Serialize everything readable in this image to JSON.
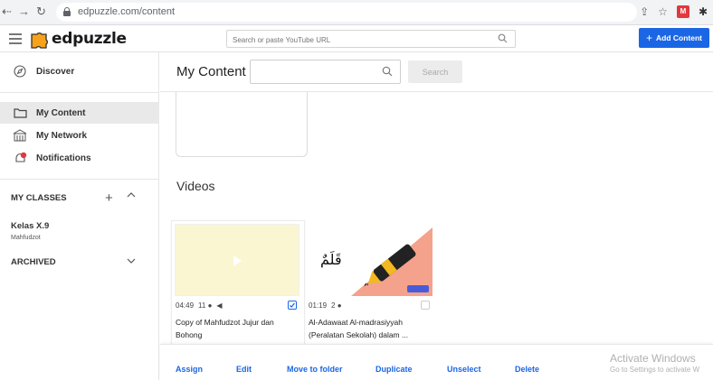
{
  "browser": {
    "url": "edpuzzle.com/content"
  },
  "header": {
    "logo_text": "edpuzzle",
    "search_placeholder": "Search or paste YouTube URL",
    "add_content_label": "Add Content"
  },
  "sidebar": {
    "discover": "Discover",
    "my_content": "My Content",
    "my_network": "My Network",
    "notifications": "Notifications",
    "my_classes": "MY CLASSES",
    "class_name": "Kelas X.9",
    "class_subject": "Mahfudzot",
    "archived": "ARCHIVED"
  },
  "main": {
    "title": "My Content",
    "search_value": "",
    "search_button": "Search",
    "videos_title": "Videos",
    "videos": [
      {
        "duration": "04:49",
        "questions": "11",
        "checked": true,
        "title": "Copy of Mahfudzot Jujur dan Bohong"
      },
      {
        "duration": "01:19",
        "questions": "2",
        "checked": false,
        "arabic": "قَلَمٌ",
        "title": "Al-Adawaat Al-madrasiyyah (Peralatan Sekolah) dalam ..."
      }
    ]
  },
  "actions": {
    "assign": "Assign",
    "edit": "Edit",
    "move": "Move to folder",
    "duplicate": "Duplicate",
    "unselect": "Unselect",
    "delete": "Delete"
  },
  "watermark": {
    "line1": "Activate Windows",
    "line2": "Go to Settings to activate W"
  },
  "colors": {
    "accent": "#1b66e5",
    "logo_orange": "#f7a21b"
  }
}
